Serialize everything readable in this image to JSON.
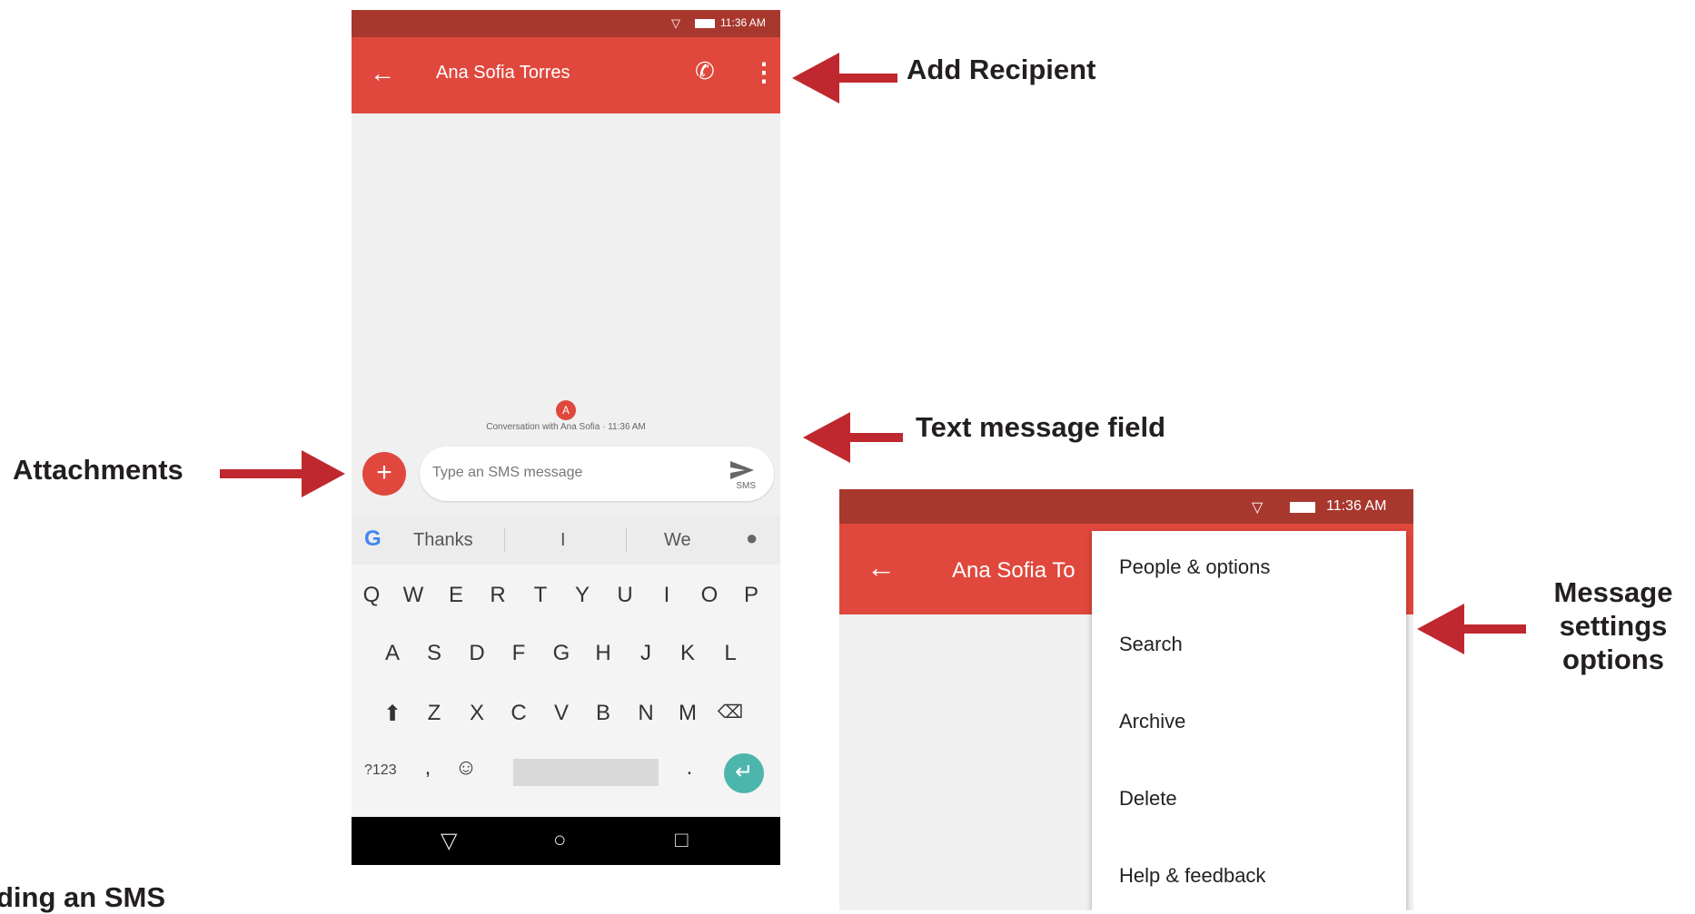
{
  "callouts": {
    "add_recipient": "Add Recipient",
    "text_message_field": "Text message field",
    "attachments": "Attachments",
    "message_settings_1": "Message",
    "message_settings_2": "settings",
    "message_settings_3": "options",
    "bottom_caption": "ding an SMS"
  },
  "colors": {
    "arrow": "#c0282f",
    "appbar": "#e0483d",
    "statusbar": "#a8382e",
    "fab": "#e0483d",
    "enter": "#4db6ac"
  },
  "phone1": {
    "status_time": "11:36 AM",
    "contact_name": "Ana Sofia Torres",
    "avatar_letter": "A",
    "conversation_info": "Conversation with Ana Sofia · 11:36 AM",
    "compose_placeholder": "Type an SMS message",
    "send_label": "SMS",
    "suggestions": [
      "Thanks",
      "I",
      "We"
    ],
    "keyboard": {
      "row1": [
        "Q",
        "W",
        "E",
        "R",
        "T",
        "Y",
        "U",
        "I",
        "O",
        "P"
      ],
      "row2": [
        "A",
        "S",
        "D",
        "F",
        "G",
        "H",
        "J",
        "K",
        "L"
      ],
      "row3": [
        "Z",
        "X",
        "C",
        "V",
        "B",
        "N",
        "M"
      ],
      "symbols_key": "?123",
      "comma": ",",
      "period": "."
    }
  },
  "phone2": {
    "status_time": "11:36 AM",
    "contact_name_partial": "Ana Sofia To",
    "menu_items": [
      "People & options",
      "Search",
      "Archive",
      "Delete",
      "Help & feedback"
    ]
  }
}
